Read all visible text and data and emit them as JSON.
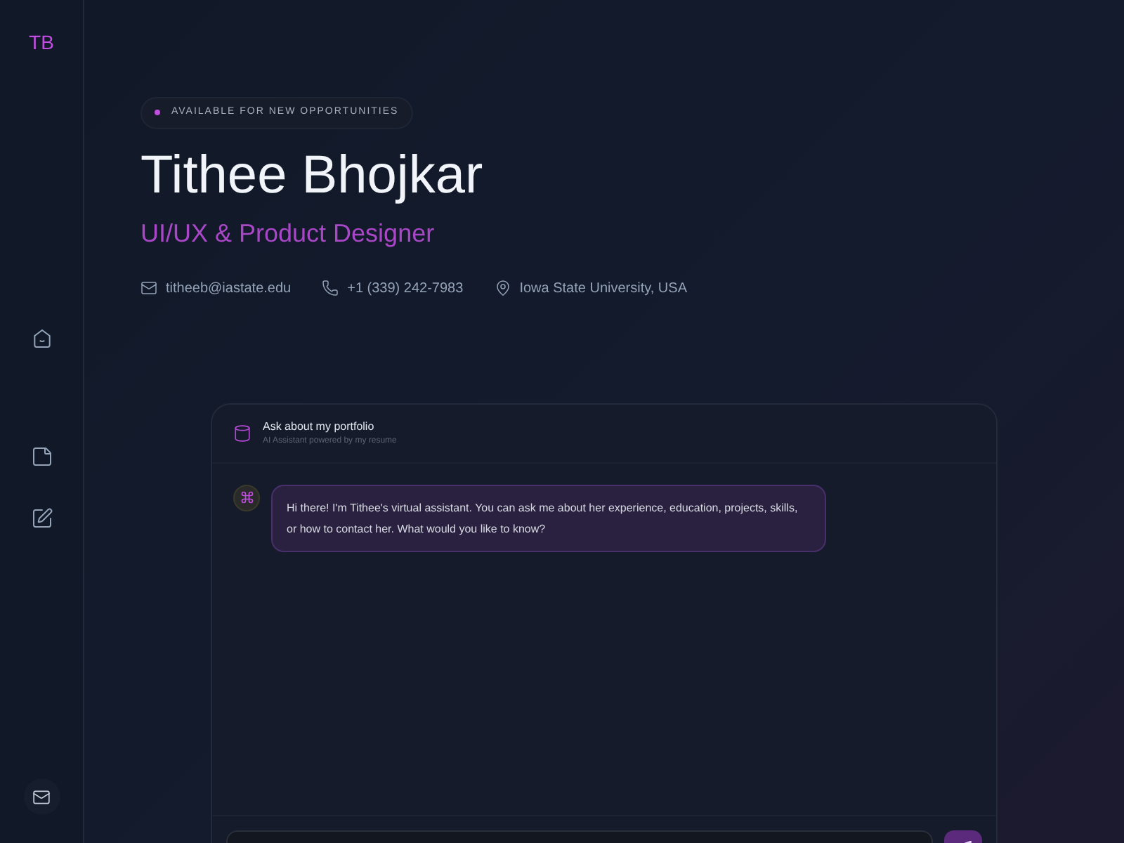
{
  "sidebar": {
    "logo": "TB"
  },
  "hero": {
    "badge": "AVAILABLE FOR NEW OPPORTUNITIES",
    "name": "Tithee Bhojkar",
    "role": "UI/UX & Product Designer",
    "contacts": [
      {
        "kind": "email",
        "text": "titheeb@iastate.edu"
      },
      {
        "kind": "phone",
        "text": "+1 (339) 242-7983"
      },
      {
        "kind": "location",
        "text": "Iowa State University, USA"
      }
    ]
  },
  "chat": {
    "title": "Ask about my portfolio",
    "subtitle": "AI Assistant powered by my resume",
    "messages": [
      {
        "kind": "assistant",
        "text": "Hi there! I'm Tithee's virtual assistant. You can ask me about her experience, education, projects, skills, or how to contact her. What would you like to know?"
      }
    ]
  }
}
